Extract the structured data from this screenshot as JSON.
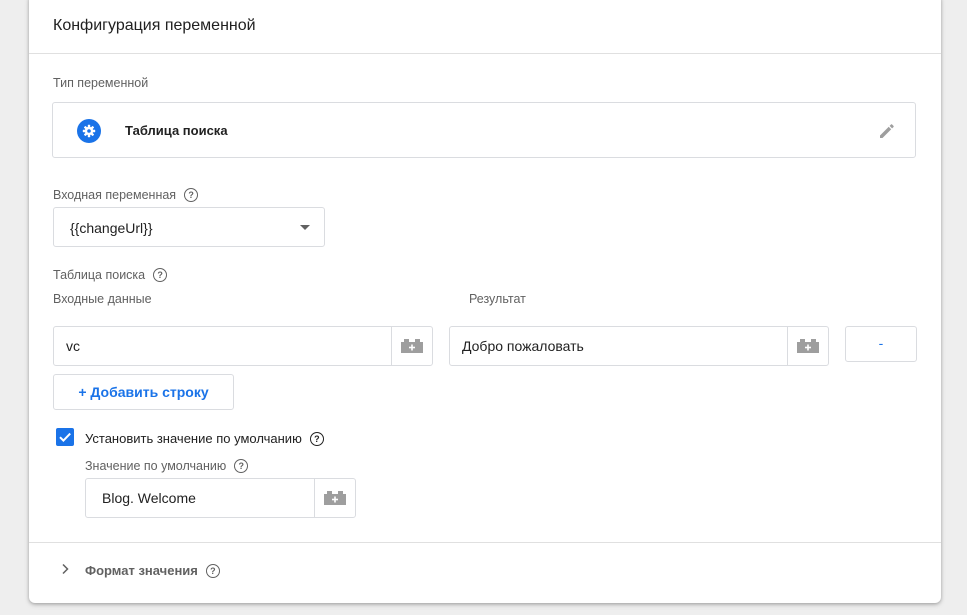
{
  "card": {
    "title": "Конфигурация переменной"
  },
  "variable_type": {
    "label": "Тип переменной",
    "name": "Таблица поиска",
    "icon": "gear-icon",
    "edit_icon": "pencil-icon"
  },
  "input_variable": {
    "label": "Входная переменная",
    "value": "{{changeUrl}}"
  },
  "lookup_table": {
    "label": "Таблица поиска",
    "col_input": "Входные данные",
    "col_output": "Результат",
    "rows": [
      {
        "input": "vc",
        "output": "Добро пожаловать"
      }
    ],
    "remove_label": "-",
    "add_row_label": "+ Добавить строку"
  },
  "default_value": {
    "checkbox_label": "Установить значение по умолчанию",
    "checked": true,
    "field_label": "Значение по умолчанию",
    "value": "Blog. Welcome"
  },
  "format": {
    "label": "Формат значения"
  },
  "colors": {
    "accent": "#1a73e8",
    "border": "#dadce0",
    "muted_text": "#616161"
  }
}
